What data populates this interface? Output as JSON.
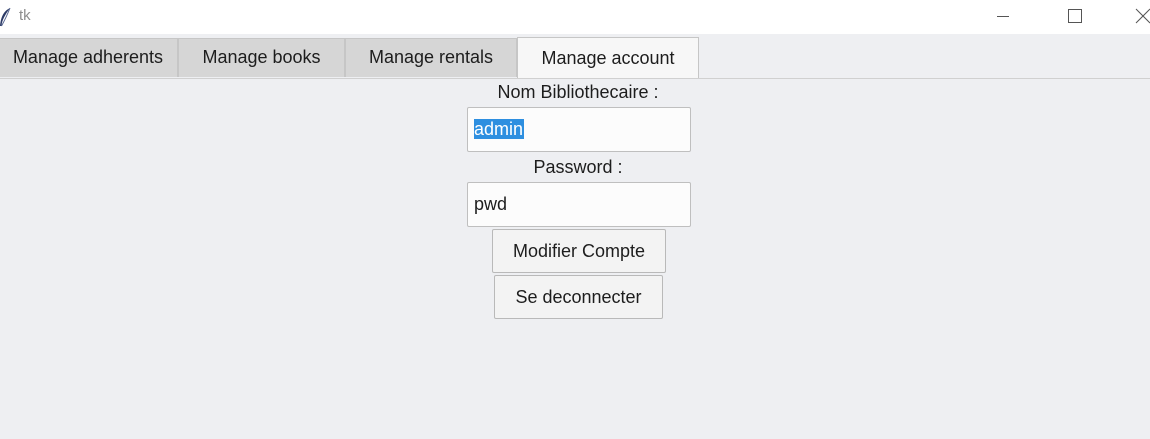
{
  "window": {
    "title": "tk"
  },
  "tabs": [
    {
      "label": "Manage adherents",
      "active": false
    },
    {
      "label": "Manage books",
      "active": false
    },
    {
      "label": "Manage rentals",
      "active": false
    },
    {
      "label": "Manage account",
      "active": true
    }
  ],
  "form": {
    "name_label": "Nom Bibliothecaire :",
    "name_value": "admin",
    "password_label": "Password :",
    "password_value": "pwd",
    "modify_button": "Modifier Compte",
    "logout_button": "Se deconnecter"
  },
  "colors": {
    "background": "#eeeff2",
    "selection": "#2e8fe0"
  }
}
